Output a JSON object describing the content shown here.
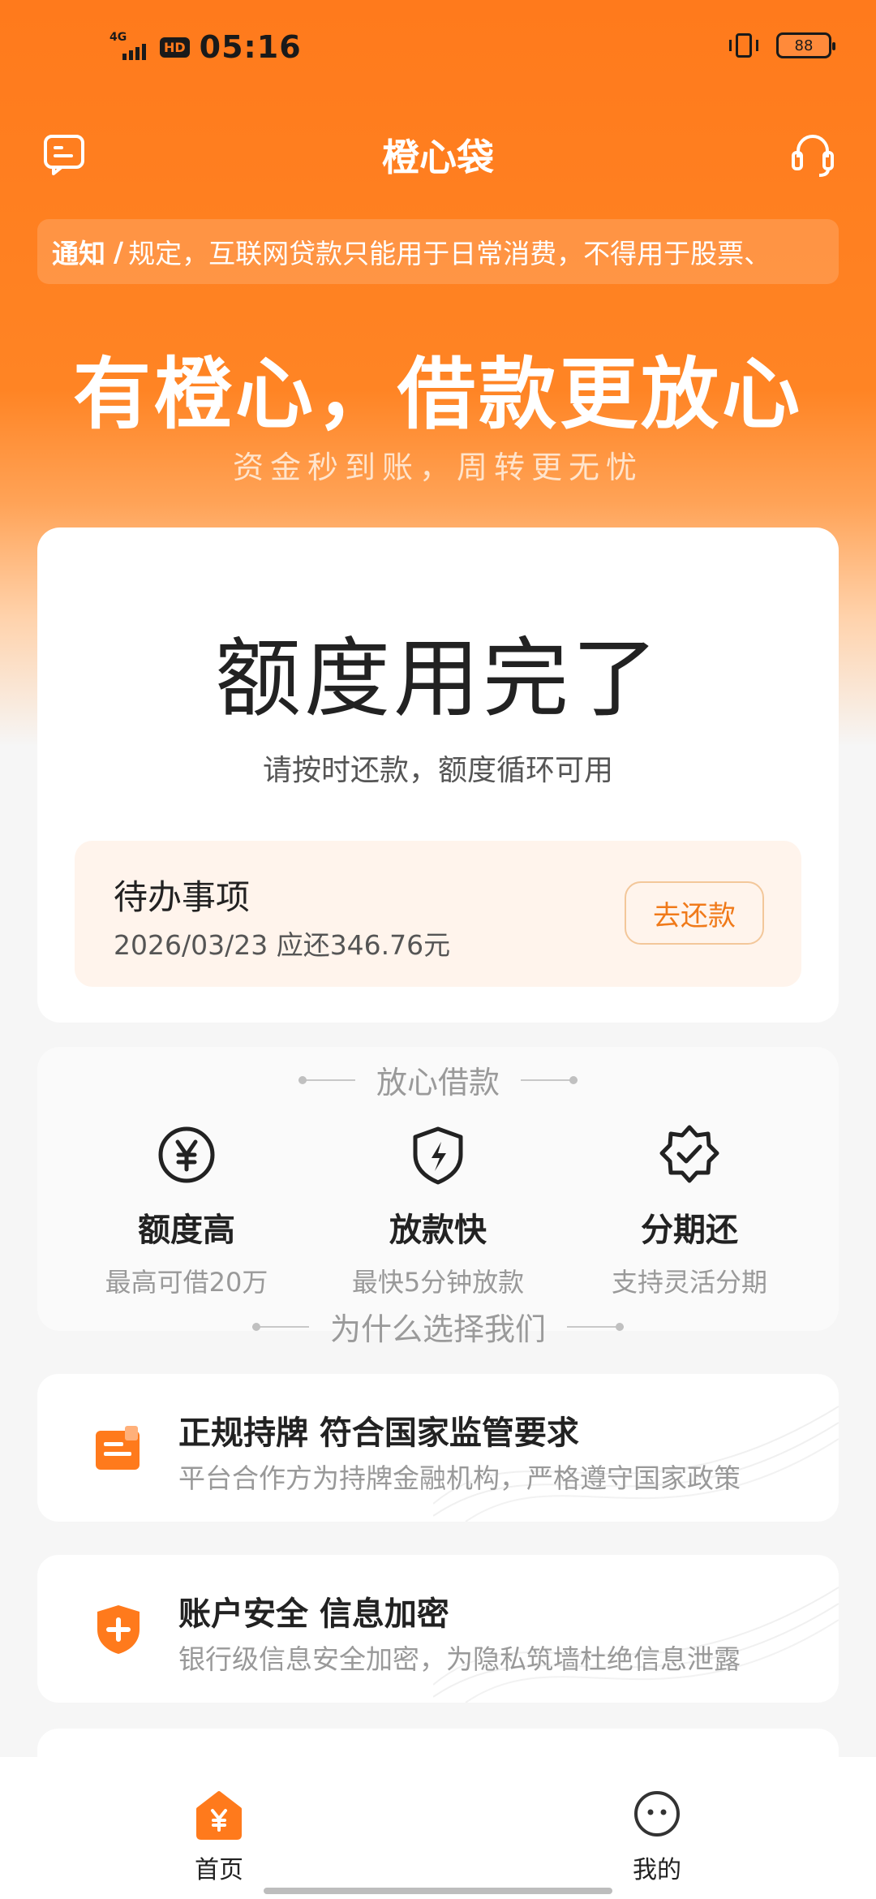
{
  "status_bar": {
    "network": "4G",
    "hd": "HD",
    "time": "05:16",
    "battery": "88"
  },
  "header": {
    "title": "橙心袋",
    "left_icon": "message-icon",
    "right_icon": "headset-icon"
  },
  "notice": {
    "tag": "通知",
    "separator": "/",
    "text": "规定，互联网贷款只能用于日常消费，不得用于股票、"
  },
  "banner": {
    "slogan": "有橙心，借款更放心",
    "subtitle": "资金秒到账，周转更无忧"
  },
  "quota_card": {
    "title": "额度用完了",
    "subtitle": "请按时还款，额度循环可用",
    "todo": {
      "title": "待办事项",
      "detail": "2026/03/23 应还346.76元",
      "button": "去还款"
    }
  },
  "features": {
    "heading": "放心借款",
    "items": [
      {
        "icon": "yuan-icon",
        "title": "额度高",
        "desc": "最高可借20万"
      },
      {
        "icon": "lightning-shield-icon",
        "title": "放款快",
        "desc": "最快5分钟放款"
      },
      {
        "icon": "check-badge-icon",
        "title": "分期还",
        "desc": "支持灵活分期"
      }
    ]
  },
  "why": {
    "heading": "为什么选择我们",
    "items": [
      {
        "icon": "license-icon",
        "title": "正规持牌 符合国家监管要求",
        "desc": "平台合作方为持牌金融机构，严格遵守国家政策"
      },
      {
        "icon": "security-shield-icon",
        "title": "账户安全 信息加密",
        "desc": "银行级信息安全加密，为隐私筑墙杜绝信息泄露"
      }
    ]
  },
  "tabbar": {
    "tabs": [
      {
        "label": "首页",
        "icon": "home-icon",
        "active": true
      },
      {
        "label": "我的",
        "icon": "profile-icon",
        "active": false
      }
    ]
  },
  "colors": {
    "brand": "#ff7a1c",
    "accent_text": "#f07a1a"
  }
}
